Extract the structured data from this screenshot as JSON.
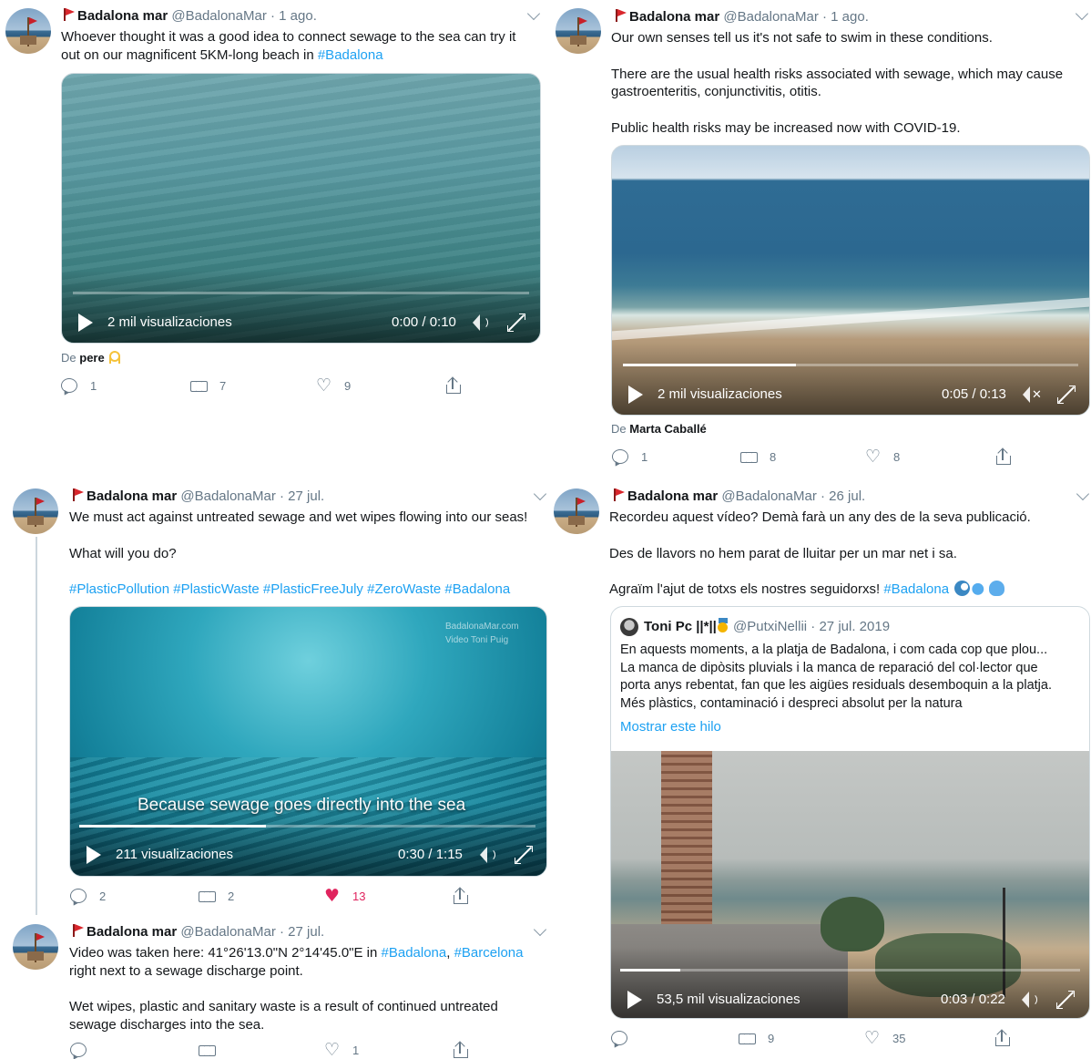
{
  "tweet1": {
    "name": "Badalona mar",
    "handle": "@BadalonaMar",
    "sep": "·",
    "time": "1 ago.",
    "text_line1": "Whoever thought it was a good idea to connect sewage to the sea can try it",
    "text_line2_prefix": "out on our magnificent 5KM-long beach in ",
    "hashtag": "#Badalona",
    "video": {
      "views": "2 mil visualizaciones",
      "time": "0:00 / 0:10",
      "progress": 0.0
    },
    "from_prefix": "De",
    "from_name": "pere",
    "replies": "1",
    "retweets": "7",
    "likes": "9"
  },
  "tweet2": {
    "name": "Badalona mar",
    "handle": "@BadalonaMar",
    "sep": "·",
    "time": "1 ago.",
    "p1": "Our own senses tell us it's not safe to swim in these conditions.",
    "p2_line1": "There are the usual health risks associated with sewage, which may cause",
    "p2_line2": "gastroenteritis, conjunctivitis, otitis.",
    "p3": "Public health risks may be increased now with COVID-19.",
    "video": {
      "views": "2 mil visualizaciones",
      "time": "0:05 / 0:13",
      "progress": 0.38
    },
    "from_prefix": "De",
    "from_name": "Marta Caballé",
    "replies": "1",
    "retweets": "8",
    "likes": "8"
  },
  "tweet3": {
    "name": "Badalona mar",
    "handle": "@BadalonaMar",
    "sep": "·",
    "time": "27 jul.",
    "p1": "We must act against untreated sewage and wet wipes flowing into our seas!",
    "p2": "What will you do?",
    "hashtags": [
      "#PlasticPollution",
      "#PlasticWaste",
      "#PlasticFreeJuly",
      "#ZeroWaste",
      "#Badalona"
    ],
    "video": {
      "views": "211 visualizaciones",
      "time": "0:30 / 1:15",
      "progress": 0.41,
      "caption": "Because sewage goes directly into the sea",
      "watermark1": "BadalonaMar.com",
      "watermark2": "Video Toni Puig"
    },
    "replies": "2",
    "retweets": "2",
    "likes": "13"
  },
  "tweet4": {
    "name": "Badalona mar",
    "handle": "@BadalonaMar",
    "sep": "·",
    "time": "27 jul.",
    "line1_prefix": "Video was taken here: 41°26'13.0\"N 2°14'45.0\"E in ",
    "tag1": "#Badalona",
    "comma": ",",
    "tag2": "#Barcelona",
    "line2": "right next to a sewage discharge point.",
    "p2_line1": "Wet wipes, plastic and sanitary waste is a result of continued untreated",
    "p2_line2": "sewage discharges into the sea.",
    "replies": "",
    "retweets": "",
    "likes": "1"
  },
  "tweet5": {
    "name": "Badalona mar",
    "handle": "@BadalonaMar",
    "sep": "·",
    "time": "26 jul.",
    "p1": "Recordeu aquest vídeo? Demà farà un any des de la seva publicació.",
    "p2": "Des de llavors no hem parat de lluitar per un mar net i sa.",
    "p3_prefix": "Agraïm l'ajut de totxs els nostres seguidorxs! ",
    "hashtag": "#Badalona",
    "quote": {
      "name": "Toni Pc ||*||",
      "handle": "@PutxiNellii",
      "sep": "·",
      "time": "27 jul. 2019",
      "line1": "En aquests moments, a la platja de Badalona, i com cada cop que plou...",
      "line2": "La manca de dipòsits pluvials i la manca de reparació del col·lector que",
      "line3": "porta anys rebentat, fan que les aigües residuals desemboquin a la platja.",
      "line4": "Més plàstics, contaminació i despreci absolut per la natura",
      "show_thread": "Mostrar este hilo"
    },
    "video": {
      "views": "53,5 mil visualizaciones",
      "time": "0:03 / 0:22",
      "progress": 0.13
    },
    "replies": "",
    "retweets": "9",
    "likes": "35"
  },
  "icons": {
    "reply": "reply-icon",
    "retweet": "retweet-icon",
    "like": "heart-icon",
    "share": "share-icon",
    "play": "play-icon",
    "volume": "volume-icon",
    "mute": "volume-muted-icon",
    "expand": "fullscreen-icon",
    "caret": "chevron-down-icon",
    "flag": "red-flag-icon"
  },
  "colors": {
    "link": "#1da1f2",
    "like_active": "#e0245e",
    "flag": "#d9262c",
    "muted_text": "#657786"
  }
}
